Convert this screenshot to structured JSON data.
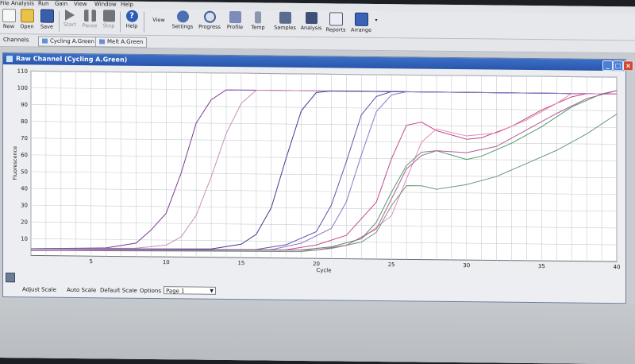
{
  "menu": [
    "File",
    "Analysis",
    "Run",
    "Gain",
    "View",
    "Window",
    "Help"
  ],
  "toolbar": {
    "new": "New",
    "open": "Open",
    "save": "Save",
    "start": "Start",
    "pause": "Pause",
    "stop": "Stop",
    "help": "Help",
    "view_label": "View",
    "settings": "Settings",
    "progress": "Progress",
    "profile": "Profile",
    "temp": "Temp",
    "samples": "Samples",
    "analysis": "Analysis",
    "reports": "Reports",
    "arrange": "Arrange"
  },
  "channels": {
    "label": "Channels",
    "tabs": [
      "Cycling A.Green",
      "Melt A.Green"
    ]
  },
  "window": {
    "title": "Raw Channel (Cycling A.Green)"
  },
  "bottom": {
    "adjust_scale": "Adjust Scale",
    "auto_scale": "Auto Scale",
    "default_scale": "Default Scale",
    "options": "Options",
    "page": "Page 1"
  },
  "colors": {
    "titlebar": "#2a56ab",
    "plot_bg": "#ffffff",
    "grid": "#c9ccd2"
  },
  "chart_data": {
    "type": "line",
    "title": "",
    "xlabel": "Cycle",
    "ylabel": "Fluorescence",
    "xlim": [
      1,
      40
    ],
    "ylim": [
      0,
      110
    ],
    "grid": true,
    "x_ticks": [
      5,
      10,
      15,
      20,
      25,
      30,
      35,
      40
    ],
    "y_ticks": [
      10,
      20,
      30,
      40,
      50,
      60,
      70,
      80,
      90,
      100,
      110
    ],
    "series": [
      {
        "color": "#7a3c8c",
        "points": [
          [
            1,
            4
          ],
          [
            6,
            5
          ],
          [
            8,
            8
          ],
          [
            9,
            16
          ],
          [
            10,
            26
          ],
          [
            11,
            50
          ],
          [
            12,
            80
          ],
          [
            13,
            94
          ],
          [
            14,
            100
          ],
          [
            17,
            100
          ],
          [
            40,
            100
          ]
        ]
      },
      {
        "color": "#c78fb8",
        "points": [
          [
            1,
            4
          ],
          [
            8,
            5
          ],
          [
            10,
            7
          ],
          [
            11,
            12
          ],
          [
            12,
            25
          ],
          [
            13,
            48
          ],
          [
            14,
            74
          ],
          [
            15,
            92
          ],
          [
            16,
            100
          ],
          [
            40,
            100
          ]
        ]
      },
      {
        "color": "#3f3c8c",
        "points": [
          [
            1,
            4
          ],
          [
            13,
            5
          ],
          [
            15,
            8
          ],
          [
            16,
            14
          ],
          [
            17,
            30
          ],
          [
            18,
            60
          ],
          [
            19,
            88
          ],
          [
            20,
            99
          ],
          [
            21,
            100
          ],
          [
            40,
            100
          ]
        ]
      },
      {
        "color": "#5a57a8",
        "points": [
          [
            1,
            3
          ],
          [
            16,
            5
          ],
          [
            18,
            8
          ],
          [
            20,
            16
          ],
          [
            21,
            32
          ],
          [
            22,
            58
          ],
          [
            23,
            86
          ],
          [
            24,
            97
          ],
          [
            25,
            100
          ],
          [
            40,
            100
          ]
        ]
      },
      {
        "color": "#8a77c2",
        "points": [
          [
            1,
            3
          ],
          [
            17,
            5
          ],
          [
            19,
            9
          ],
          [
            21,
            18
          ],
          [
            22,
            34
          ],
          [
            23,
            62
          ],
          [
            24,
            88
          ],
          [
            25,
            98
          ],
          [
            26,
            100
          ],
          [
            40,
            100
          ]
        ]
      },
      {
        "color": "#c24a8a",
        "points": [
          [
            1,
            3
          ],
          [
            18,
            5
          ],
          [
            20,
            8
          ],
          [
            22,
            14
          ],
          [
            24,
            34
          ],
          [
            25,
            60
          ],
          [
            26,
            80
          ],
          [
            27,
            82
          ],
          [
            28,
            77
          ],
          [
            30,
            72
          ],
          [
            31,
            73
          ],
          [
            33,
            80
          ],
          [
            35,
            90
          ],
          [
            37,
            98
          ],
          [
            38,
            100
          ],
          [
            40,
            100
          ]
        ]
      },
      {
        "color": "#e48ab8",
        "points": [
          [
            1,
            3
          ],
          [
            19,
            5
          ],
          [
            21,
            7
          ],
          [
            23,
            12
          ],
          [
            25,
            26
          ],
          [
            26,
            48
          ],
          [
            27,
            70
          ],
          [
            28,
            78
          ],
          [
            30,
            74
          ],
          [
            32,
            76
          ],
          [
            34,
            84
          ],
          [
            36,
            94
          ],
          [
            37,
            100
          ],
          [
            40,
            100
          ]
        ]
      },
      {
        "color": "#4f9a6a",
        "points": [
          [
            1,
            3
          ],
          [
            19,
            5
          ],
          [
            21,
            7
          ],
          [
            23,
            12
          ],
          [
            24,
            22
          ],
          [
            25,
            40
          ],
          [
            26,
            56
          ],
          [
            27,
            64
          ],
          [
            28,
            65
          ],
          [
            30,
            60
          ],
          [
            31,
            62
          ],
          [
            33,
            70
          ],
          [
            35,
            80
          ],
          [
            37,
            92
          ],
          [
            39,
            100
          ],
          [
            40,
            102
          ]
        ]
      },
      {
        "color": "#6a9a7a",
        "points": [
          [
            1,
            3
          ],
          [
            19,
            4
          ],
          [
            21,
            6
          ],
          [
            23,
            10
          ],
          [
            24,
            16
          ],
          [
            25,
            32
          ],
          [
            26,
            44
          ],
          [
            27,
            44
          ],
          [
            28,
            42
          ],
          [
            30,
            45
          ],
          [
            32,
            50
          ],
          [
            34,
            58
          ],
          [
            36,
            66
          ],
          [
            38,
            76
          ],
          [
            40,
            88
          ]
        ]
      },
      {
        "color": "#b55a9a",
        "points": [
          [
            1,
            3
          ],
          [
            20,
            5
          ],
          [
            22,
            8
          ],
          [
            24,
            18
          ],
          [
            25,
            36
          ],
          [
            26,
            54
          ],
          [
            27,
            62
          ],
          [
            28,
            65
          ],
          [
            30,
            64
          ],
          [
            32,
            68
          ],
          [
            34,
            78
          ],
          [
            36,
            88
          ],
          [
            38,
            97
          ],
          [
            40,
            102
          ]
        ]
      }
    ]
  }
}
